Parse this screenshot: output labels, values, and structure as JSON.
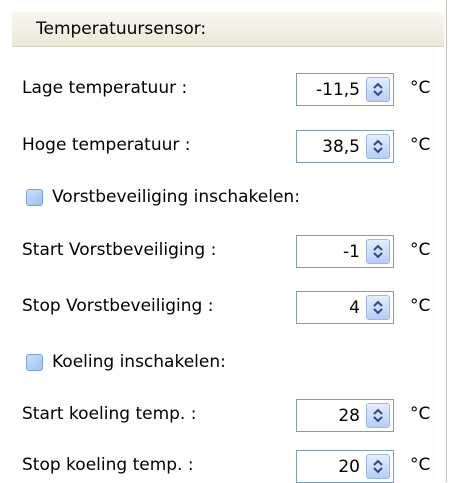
{
  "section": {
    "title": "Temperatuursensor:"
  },
  "rows": {
    "low_temp": {
      "label": "Lage temperatuur :",
      "value": "-11,5",
      "unit": "°C"
    },
    "high_temp": {
      "label": "Hoge temperatuur :",
      "value": "38,5",
      "unit": "°C"
    },
    "frost_start": {
      "label": "Start Vorstbeveiliging :",
      "value": "-1",
      "unit": "°C"
    },
    "frost_stop": {
      "label": "Stop Vorstbeveiliging :",
      "value": "4",
      "unit": "°C"
    },
    "cool_start": {
      "label": "Start koeling temp. :",
      "value": "28",
      "unit": "°C"
    },
    "cool_stop": {
      "label": "Stop koeling temp. :",
      "value": "20",
      "unit": "°C"
    }
  },
  "checkboxes": {
    "frost_enable": {
      "label": "Vorstbeveiliging inschakelen:",
      "checked": false
    },
    "cool_enable": {
      "label": "Koeling inschakelen:",
      "checked": false
    }
  },
  "icons": {
    "spin_button": "spin-updown-icon"
  },
  "colors": {
    "field_border": "#7f9db9",
    "spin_button": "#b7cdf7",
    "checkbox": "#9ec3ee"
  }
}
